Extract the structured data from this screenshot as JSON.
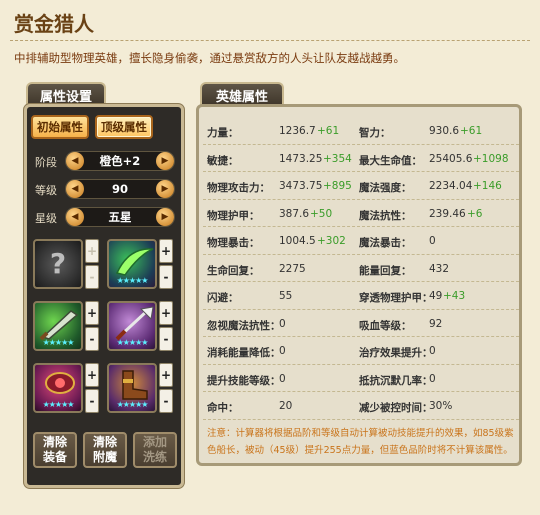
{
  "title": "赏金猎人",
  "description": "中排辅助型物理英雄，擅长隐身偷袭，通过悬赏敌方的人头让队友越战越勇。",
  "left_panel": {
    "tab": "属性设置",
    "btn_initial": "初始属性",
    "btn_top": "顶级属性",
    "stage_label": "阶段",
    "stage_value": "橙色+2",
    "level_label": "等级",
    "level_value": "90",
    "star_label": "星级",
    "star_value": "五星",
    "arrow_left": "◀",
    "arrow_right": "▶",
    "plus": "+",
    "minus": "-",
    "unknown_slot": "?",
    "slot_stars": "★★★★★",
    "btn_clear_equip_1": "清除",
    "btn_clear_equip_2": "装备",
    "btn_clear_ench_1": "清除",
    "btn_clear_ench_2": "附魔",
    "btn_add_wash_1": "添加",
    "btn_add_wash_2": "洗练"
  },
  "right_panel": {
    "tab": "英雄属性",
    "rows": [
      {
        "k1": "力量：",
        "v1": "1236.7",
        "p1": "+61",
        "k2": "智力：",
        "v2": "930.6",
        "p2": "+61"
      },
      {
        "k1": "敏捷：",
        "v1": "1473.25",
        "p1": "+354",
        "k2": "最大生命值：",
        "v2": "25405.6",
        "p2": "+1098"
      },
      {
        "k1": "物理攻击力：",
        "v1": "3473.75",
        "p1": "+895",
        "k2": "魔法强度：",
        "v2": "2234.04",
        "p2": "+146"
      },
      {
        "k1": "物理护甲：",
        "v1": "387.6",
        "p1": "+50",
        "k2": "魔法抗性：",
        "v2": "239.46",
        "p2": "+6"
      },
      {
        "k1": "物理暴击：",
        "v1": "1004.5",
        "p1": "+302",
        "k2": "魔法暴击：",
        "v2": "0",
        "p2": ""
      },
      {
        "k1": "生命回复：",
        "v1": "2275",
        "p1": "",
        "k2": "能量回复：",
        "v2": "432",
        "p2": ""
      },
      {
        "k1": "闪避：",
        "v1": "55",
        "p1": "",
        "k2": "穿透物理护甲：",
        "v2": "49",
        "p2": "+43"
      },
      {
        "k1": "忽视魔法抗性：",
        "v1": "0",
        "p1": "",
        "k2": "吸血等级：",
        "v2": "92",
        "p2": ""
      },
      {
        "k1": "消耗能量降低：",
        "v1": "0",
        "p1": "",
        "k2": "治疗效果提升：",
        "v2": "0",
        "p2": ""
      },
      {
        "k1": "提升技能等级：",
        "v1": "0",
        "p1": "",
        "k2": "抵抗沉默几率：",
        "v2": "0",
        "p2": ""
      },
      {
        "k1": "命中：",
        "v1": "20",
        "p1": "",
        "k2": "减少被控时间：",
        "v2": "30%",
        "p2": ""
      }
    ],
    "note": "注意：计算器将根据品阶和等级自动计算被动技能提升的效果，如85级紫色船长，被动（45级）提升255点力量，但蓝色品阶时将不计算该属性。"
  }
}
